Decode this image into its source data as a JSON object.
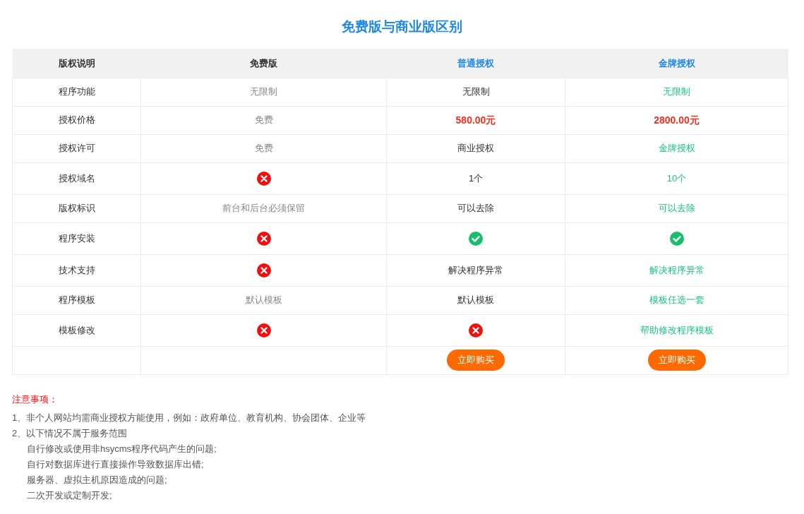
{
  "title": "免费版与商业版区别",
  "table": {
    "columns": [
      {
        "label": "版权说明",
        "highlight": false
      },
      {
        "label": "免费版",
        "highlight": false
      },
      {
        "label": "普通授权",
        "highlight": true
      },
      {
        "label": "金牌授权",
        "highlight": true
      }
    ],
    "rows": [
      {
        "cells": [
          {
            "kind": "label",
            "text": "程序功能"
          },
          {
            "kind": "muted",
            "text": "无限制"
          },
          {
            "kind": "plain",
            "text": "无限制"
          },
          {
            "kind": "accent",
            "text": "无限制"
          }
        ]
      },
      {
        "cells": [
          {
            "kind": "label",
            "text": "授权价格"
          },
          {
            "kind": "muted",
            "text": "免费"
          },
          {
            "kind": "price",
            "text": "580.00元"
          },
          {
            "kind": "price",
            "text": "2800.00元"
          }
        ]
      },
      {
        "cells": [
          {
            "kind": "label",
            "text": "授权许可"
          },
          {
            "kind": "muted",
            "text": "免费"
          },
          {
            "kind": "plain",
            "text": "商业授权"
          },
          {
            "kind": "accent",
            "text": "金牌授权"
          }
        ]
      },
      {
        "cells": [
          {
            "kind": "label",
            "text": "授权域名"
          },
          {
            "kind": "no"
          },
          {
            "kind": "plain",
            "text": "1个"
          },
          {
            "kind": "accent",
            "text": "10个"
          }
        ]
      },
      {
        "cells": [
          {
            "kind": "label",
            "text": "版权标识"
          },
          {
            "kind": "muted",
            "text": "前台和后台必须保留"
          },
          {
            "kind": "plain",
            "text": "可以去除"
          },
          {
            "kind": "accent",
            "text": "可以去除"
          }
        ]
      },
      {
        "cells": [
          {
            "kind": "label",
            "text": "程序安装"
          },
          {
            "kind": "no"
          },
          {
            "kind": "yes"
          },
          {
            "kind": "yes"
          }
        ]
      },
      {
        "cells": [
          {
            "kind": "label",
            "text": "技术支持"
          },
          {
            "kind": "no"
          },
          {
            "kind": "plain",
            "text": "解决程序异常"
          },
          {
            "kind": "accent",
            "text": "解决程序异常"
          }
        ]
      },
      {
        "cells": [
          {
            "kind": "label",
            "text": "程序模板"
          },
          {
            "kind": "muted",
            "text": "默认模板"
          },
          {
            "kind": "plain",
            "text": "默认模板"
          },
          {
            "kind": "accent",
            "text": "模板任选一套"
          }
        ]
      },
      {
        "cells": [
          {
            "kind": "label",
            "text": "模板修改"
          },
          {
            "kind": "no"
          },
          {
            "kind": "no"
          },
          {
            "kind": "accent",
            "text": "帮助修改程序模板"
          }
        ]
      },
      {
        "cells": [
          {
            "kind": "empty"
          },
          {
            "kind": "empty"
          },
          {
            "kind": "button",
            "text": "立即购买"
          },
          {
            "kind": "button",
            "text": "立即购买"
          }
        ]
      }
    ]
  },
  "notes": {
    "heading": "注意事项：",
    "items": [
      {
        "text": "1、非个人网站均需商业授权方能使用，例如：政府单位、教育机构、协会团体、企业等"
      },
      {
        "text": "2、以下情况不属于服务范围",
        "children": [
          {
            "text": "自行修改或使用非hsycms程序代码产生的问题;"
          },
          {
            "text": "自行对数据库进行直接操作导致数据库出错;"
          },
          {
            "text": "服务器、虚拟主机原因造成的问题;"
          },
          {
            "text": "二次开发或定制开发;"
          }
        ]
      }
    ]
  }
}
